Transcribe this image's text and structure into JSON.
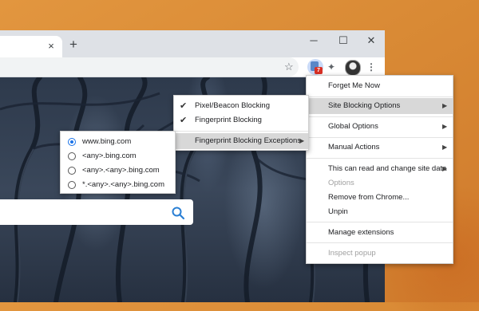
{
  "theme": {
    "accent": "#1a73e8",
    "badge_color": "#d93025",
    "highlight": "#d8d8d8"
  },
  "browser": {
    "tab_close_icon": "×",
    "new_tab_icon": "+",
    "window_controls": {
      "minimize": "─",
      "maximize": "☐",
      "close": "✕"
    },
    "toolbar": {
      "bookmark_star_icon": "☆",
      "extension_badge_count": "7",
      "extensions_icon": "✦",
      "menu_icon": "⋮"
    }
  },
  "context_menu": {
    "items": [
      {
        "label": "Forget Me Now"
      },
      {
        "label": "Site Blocking Options",
        "submenu": true,
        "highlighted": true
      },
      {
        "label": "Global Options",
        "submenu": true
      },
      {
        "label": "Manual Actions",
        "submenu": true
      },
      {
        "label": "This can read and change site data",
        "submenu": true
      },
      {
        "label": "Options",
        "disabled": true
      },
      {
        "label": "Remove from Chrome..."
      },
      {
        "label": "Unpin"
      },
      {
        "label": "Manage extensions"
      },
      {
        "label": "Inspect popup",
        "disabled": true
      }
    ]
  },
  "site_blocking_submenu": {
    "items": [
      {
        "label": "Pixel/Beacon Blocking",
        "checked": true
      },
      {
        "label": "Fingerprint Blocking",
        "checked": true
      },
      {
        "label": "Fingerprint Blocking Exceptions",
        "submenu": true,
        "highlighted": true
      }
    ]
  },
  "exceptions_submenu": {
    "selected": "www.bing.com",
    "items": [
      {
        "label": "www.bing.com",
        "selected": true
      },
      {
        "label": "<any>.bing.com",
        "selected": false
      },
      {
        "label": "<any>.<any>.bing.com",
        "selected": false
      },
      {
        "label": "*.<any>.<any>.bing.com",
        "selected": false
      }
    ]
  },
  "arrow_glyph": "▶"
}
